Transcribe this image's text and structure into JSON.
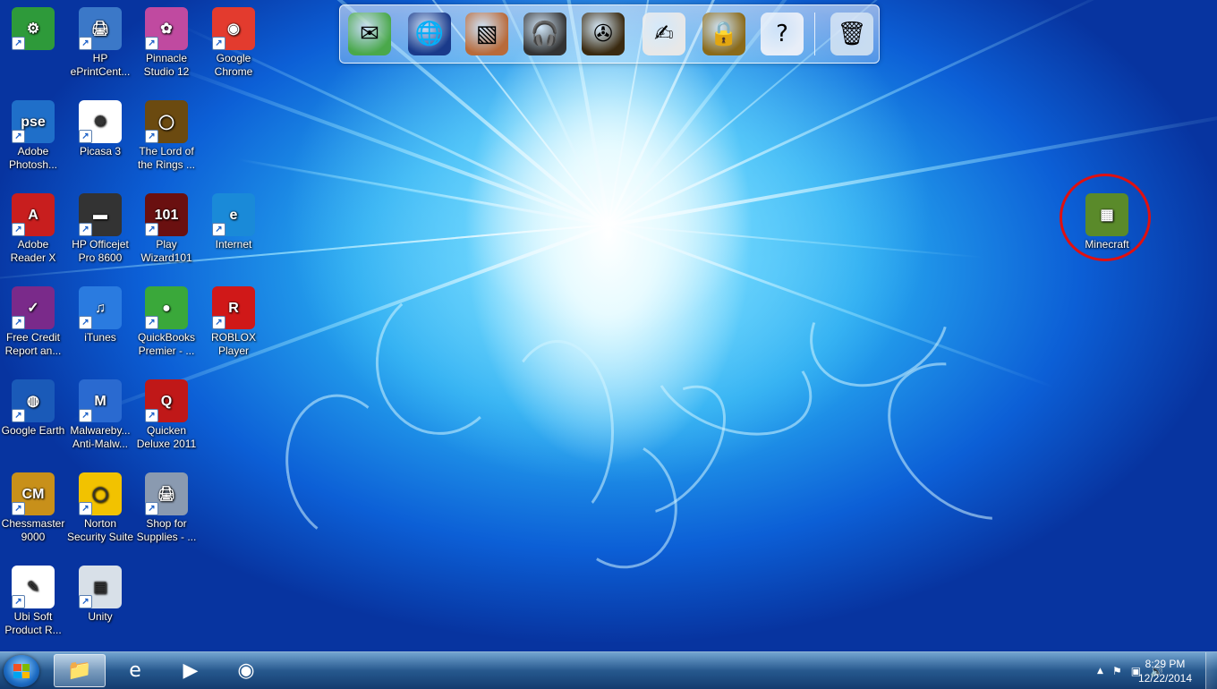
{
  "desktop_icons": [
    {
      "name": "control-panel-icon",
      "label": "",
      "color": "#2e9a3a",
      "glyph": "⚙"
    },
    {
      "name": "hp-eprintcenter-icon",
      "label": "HP ePrintCent...",
      "color": "#3b78c8",
      "glyph": "🖨"
    },
    {
      "name": "pinnacle-studio-icon",
      "label": "Pinnacle Studio 12",
      "color": "#c04aa0",
      "glyph": "✿"
    },
    {
      "name": "google-chrome-icon",
      "label": "Google Chrome",
      "color": "#e33b2e",
      "glyph": "◉"
    },
    {
      "name": "adobe-photoshop-icon",
      "label": "Adobe Photosh...",
      "color": "#1f6fc9",
      "glyph": "pse"
    },
    {
      "name": "picasa-icon",
      "label": "Picasa 3",
      "color": "#ffffff",
      "glyph": "✺"
    },
    {
      "name": "lotr-icon",
      "label": "The Lord of the Rings ...",
      "color": "#6b4a10",
      "glyph": "◯"
    },
    {
      "name": "adobe-reader-icon",
      "label": "Adobe Reader X",
      "color": "#c81e1e",
      "glyph": "A"
    },
    {
      "name": "hp-officejet-icon",
      "label": "HP Officejet Pro 8600",
      "color": "#333333",
      "glyph": "▬"
    },
    {
      "name": "wizard101-icon",
      "label": "Play Wizard101",
      "color": "#6a1010",
      "glyph": "101"
    },
    {
      "name": "internet-explorer-icon",
      "label": "Internet",
      "color": "#1a8ad8",
      "glyph": "e"
    },
    {
      "name": "experian-icon",
      "label": "Free Credit Report an...",
      "color": "#7a2a8a",
      "glyph": "✓"
    },
    {
      "name": "itunes-icon",
      "label": "iTunes",
      "color": "#2a7be0",
      "glyph": "♫"
    },
    {
      "name": "quickbooks-icon",
      "label": "QuickBooks Premier - ...",
      "color": "#3aa83a",
      "glyph": "●"
    },
    {
      "name": "roblox-icon",
      "label": "ROBLOX Player",
      "color": "#d01818",
      "glyph": "R"
    },
    {
      "name": "google-earth-icon",
      "label": "Google Earth",
      "color": "#1a5ab8",
      "glyph": "◍"
    },
    {
      "name": "malwarebytes-icon",
      "label": "Malwareby... Anti-Malw...",
      "color": "#2a6ad0",
      "glyph": "M"
    },
    {
      "name": "quicken-icon",
      "label": "Quicken Deluxe 2011",
      "color": "#c01818",
      "glyph": "Q"
    },
    {
      "name": "chessmaster-icon",
      "label": "Chessmaster 9000",
      "color": "#c8901a",
      "glyph": "CM"
    },
    {
      "name": "norton-icon",
      "label": "Norton Security Suite",
      "color": "#f2c200",
      "glyph": "◯"
    },
    {
      "name": "shop-supplies-icon",
      "label": "Shop for Supplies - ...",
      "color": "#8a9ab0",
      "glyph": "🖨"
    },
    {
      "name": "ubisoft-icon",
      "label": "Ubi Soft Product R...",
      "color": "#ffffff",
      "glyph": "✎"
    },
    {
      "name": "unity-icon",
      "label": "Unity",
      "color": "#d8e0e8",
      "glyph": "▤"
    },
    {
      "name": "minecraft-icon",
      "label": "Minecraft",
      "color": "#5a8a2a",
      "glyph": "▦"
    }
  ],
  "dock": [
    {
      "name": "mail-icon",
      "glyph": "✉",
      "color": "#4aa84a"
    },
    {
      "name": "globe-icon",
      "glyph": "🌐",
      "color": "#1a3a8a"
    },
    {
      "name": "photos-icon",
      "glyph": "▧",
      "color": "#b86a3a"
    },
    {
      "name": "headphones-icon",
      "glyph": "🎧",
      "color": "#333333"
    },
    {
      "name": "film-reel-icon",
      "glyph": "✇",
      "color": "#3a2a10"
    },
    {
      "name": "notepad-icon",
      "glyph": "✍",
      "color": "#e8e8e8"
    },
    {
      "name": "lock-icon",
      "glyph": "🔒",
      "color": "#8a6a1a"
    },
    {
      "name": "help-icon",
      "glyph": "?",
      "color": "#e8eef8"
    },
    {
      "name": "recycle-bin-icon",
      "glyph": "🗑",
      "color": "#c8dcf0"
    }
  ],
  "taskbar": {
    "pinned": [
      {
        "name": "windows-explorer-icon",
        "glyph": "📁",
        "active": true
      },
      {
        "name": "internet-explorer-taskbar-icon",
        "glyph": "e",
        "active": false
      },
      {
        "name": "media-player-icon",
        "glyph": "▶",
        "active": false
      },
      {
        "name": "chrome-taskbar-icon",
        "glyph": "◉",
        "active": false
      }
    ],
    "tray_expand": "▲",
    "time": "8:29 PM",
    "date": "12/22/2014"
  }
}
